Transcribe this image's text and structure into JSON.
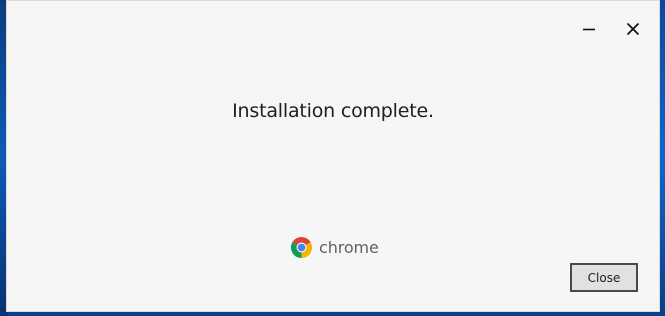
{
  "window": {
    "minimize_icon": "minimize-icon",
    "close_icon": "close-icon"
  },
  "content": {
    "message": "Installation complete."
  },
  "brand": {
    "logo_icon": "chrome-logo-icon",
    "name": "chrome"
  },
  "footer": {
    "close_label": "Close"
  },
  "colors": {
    "window_bg": "#f6f6f6",
    "desktop_bg": "#0b58b8",
    "chrome_red": "#db4437",
    "chrome_yellow": "#f4b400",
    "chrome_green": "#0f9d58",
    "chrome_blue": "#4285f4"
  }
}
